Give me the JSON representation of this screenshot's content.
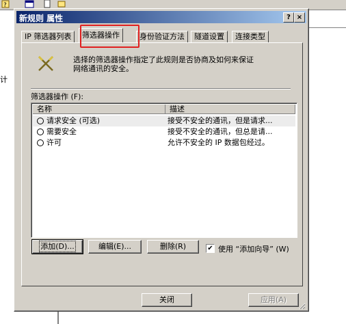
{
  "background": {
    "left_text": "计"
  },
  "dialog": {
    "title": "新规则 属性",
    "help_button": "?",
    "close_button": "×",
    "tabs": [
      {
        "label": "IP 筛选器列表"
      },
      {
        "label": "筛选器操作"
      },
      {
        "label": "身份验证方法"
      },
      {
        "label": "隧道设置"
      },
      {
        "label": "连接类型"
      }
    ],
    "active_tab": "筛选器操作",
    "description_line1": "选择的筛选器操作指定了此规则是否协商及如何来保证",
    "description_line2": "网络通讯的安全。",
    "list_label": "筛选器操作 (F):",
    "columns": {
      "name": "名称",
      "desc": "描述"
    },
    "rows": [
      {
        "name": "请求安全 (可选)",
        "desc": "接受不安全的通讯，但是请求..."
      },
      {
        "name": "需要安全",
        "desc": "接受不安全的通讯，但总是请..."
      },
      {
        "name": "许可",
        "desc": "允许不安全的 IP 数据包经过。"
      }
    ],
    "buttons": {
      "add": "添加(D)...",
      "edit": "编辑(E)...",
      "remove": "删除(R)",
      "close": "关闭",
      "apply": "应用(A)"
    },
    "wizard_checkbox": {
      "label": "使用 “添加向导” (W)",
      "checked": "✔"
    }
  },
  "colors": {
    "highlight": "#e02020",
    "titlebar": "#0a246a"
  }
}
